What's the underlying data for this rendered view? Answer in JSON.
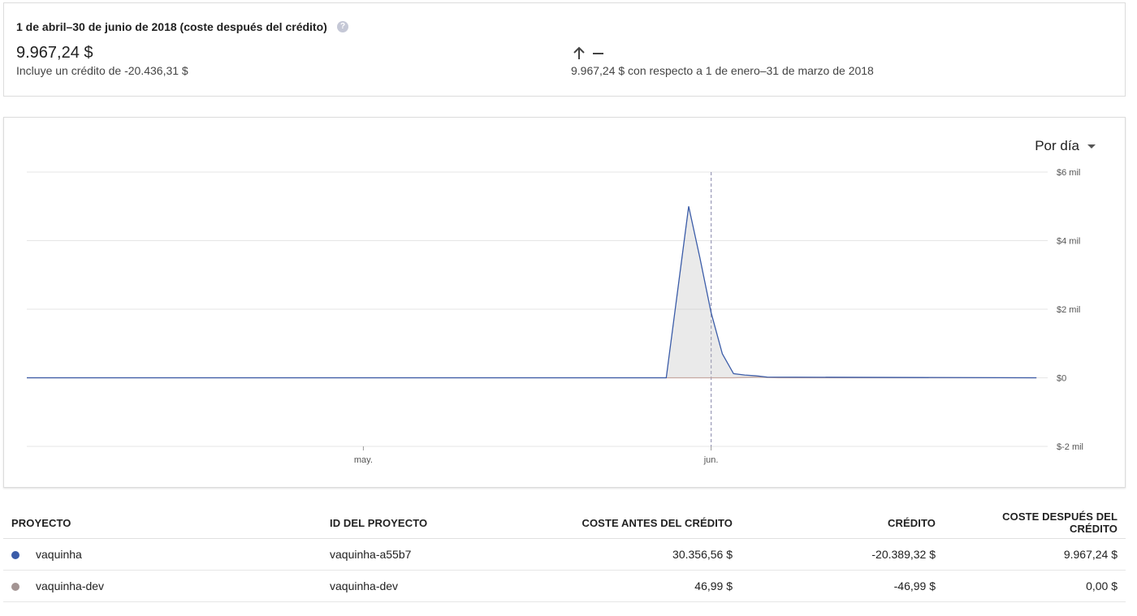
{
  "summary": {
    "period_title": "1 de abril–30 de junio de 2018 (coste después del crédito)",
    "help_icon": "help-circle-icon",
    "total": "9.967,24 $",
    "credit_note": "Incluye un crédito de -20.436,31 $",
    "trend_icon": "arrow-up-icon",
    "trend_dash": "—",
    "comparison": "9.967,24 $ con respecto a 1 de enero–31 de marzo de 2018"
  },
  "chart_controls": {
    "granularity_label": "Por día",
    "dropdown_icon": "caret-down-icon"
  },
  "chart_data": {
    "type": "area",
    "title": "",
    "xlabel": "",
    "ylabel": "",
    "x_ticks": [
      "may.",
      "jun."
    ],
    "y_ticks": [
      "$6 mil",
      "$4 mil",
      "$2 mil",
      "$0",
      "$-2 mil"
    ],
    "ylim": [
      -2000,
      6000
    ],
    "grid": true,
    "current_marker": "2018-06-01",
    "series": [
      {
        "color": "#3b5ca8",
        "points": [
          [
            "2018-04-01",
            0
          ],
          [
            "2018-05-28",
            0
          ],
          [
            "2018-05-29",
            2500
          ],
          [
            "2018-05-30",
            5000
          ],
          [
            "2018-05-31",
            3500
          ],
          [
            "2018-06-01",
            1900
          ],
          [
            "2018-06-02",
            700
          ],
          [
            "2018-06-03",
            120
          ],
          [
            "2018-06-04",
            80
          ],
          [
            "2018-06-05",
            60
          ],
          [
            "2018-06-06",
            20
          ],
          [
            "2018-06-30",
            0
          ]
        ]
      },
      {
        "color": "#c9a7a0",
        "points": [
          [
            "2018-04-01",
            0
          ],
          [
            "2018-06-03",
            0
          ],
          [
            "2018-06-04",
            10
          ],
          [
            "2018-06-05",
            25
          ],
          [
            "2018-06-06",
            10
          ],
          [
            "2018-06-07",
            0
          ],
          [
            "2018-06-30",
            0
          ]
        ]
      }
    ]
  },
  "table": {
    "headers": [
      "PROYECTO",
      "ID DEL PROYECTO",
      "COSTE ANTES DEL CRÉDITO",
      "CRÉDITO",
      "COSTE DESPUÉS DEL CRÉDITO"
    ],
    "rows": [
      {
        "color": "#3b5ca8",
        "project": "vaquinha",
        "id": "vaquinha-a55b7",
        "before": "30.356,56 $",
        "credit": "-20.389,32 $",
        "after": "9.967,24 $"
      },
      {
        "color": "#a39493",
        "project": "vaquinha-dev",
        "id": "vaquinha-dev",
        "before": "46,99 $",
        "credit": "-46,99 $",
        "after": "0,00 $"
      }
    ]
  }
}
